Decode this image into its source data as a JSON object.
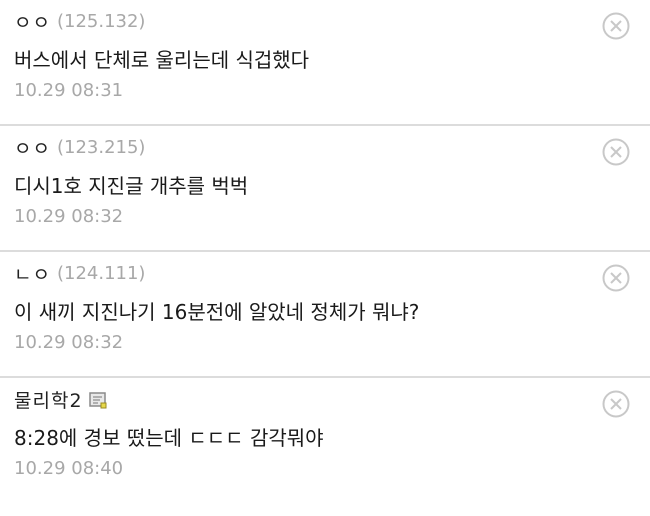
{
  "comments": [
    {
      "nickname": "ㅇㅇ",
      "ip": "(125.132)",
      "text": "버스에서 단체로 울리는데 식겁했다",
      "time": "10.29 08:31"
    },
    {
      "nickname": "ㅇㅇ",
      "ip": "(123.215)",
      "text": "디시1호 지진글 개추를 벅벅",
      "time": "10.29 08:32"
    },
    {
      "nickname": "ㄴㅇ",
      "ip": "(124.111)",
      "text": "이 새끼 지진나기 16분전에 알았네 정체가 뭐냐?",
      "time": "10.29 08:32"
    },
    {
      "nickname": "물리학2",
      "ip": "",
      "text": "8:28에 경보 떴는데 ㄷㄷㄷ 감각뭐야",
      "time": "10.29 08:40"
    }
  ],
  "icons": {
    "delete": "close-circle-icon",
    "member_badge": "fixed-nick-badge-icon"
  },
  "colors": {
    "text": "#1a1a1a",
    "muted": "#a8a8a8",
    "divider": "#dcdcdc",
    "delete_icon": "#c8c8c8"
  }
}
